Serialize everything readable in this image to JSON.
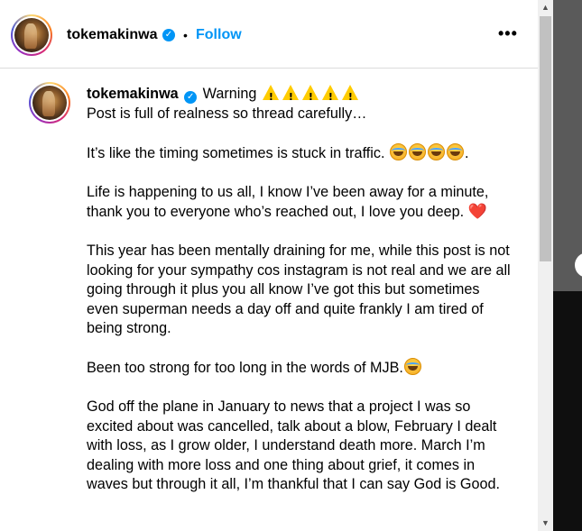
{
  "post_header": {
    "username": "tokemakinwa",
    "separator": "•",
    "follow_label": "Follow",
    "more_label": "•••"
  },
  "caption": {
    "username": "tokemakinwa",
    "warning_text": "Warning",
    "line1": "Post is full of realness so thread carefully…",
    "para2": "It’s like the timing sometimes is stuck in traffic.",
    "para2_end": ".",
    "para3": "Life is happening to us all, I know I’ve been away for a minute, thank you to everyone who’s reached out, I love you deep.",
    "heart": "❤️",
    "para4": "This year has been mentally draining for me, while this post is not looking for your sympathy cos instagram is not real and we are all going through it plus you all know I’ve got this but sometimes even superman needs a day off and quite frankly I am tired of being strong.",
    "para5": "Been too strong for too long in the words of MJB.",
    "para6": "God off the plane in January to news that a project I was so excited about was cancelled, talk about a blow, February I dealt with loss, as I grow older, I understand death more. March I’m dealing with more loss and one thing about grief, it comes in waves but through it all, I’m thankful that I can say God is Good."
  },
  "icons": {
    "verified": "verified-badge-icon",
    "warning": "warning-sign-icon",
    "sweat_smile": "grinning-face-with-sweat-icon",
    "heart": "red-heart-icon"
  },
  "colors": {
    "accent": "#0095f6",
    "heart": "#e0245e",
    "warning": "#ffcc00"
  }
}
